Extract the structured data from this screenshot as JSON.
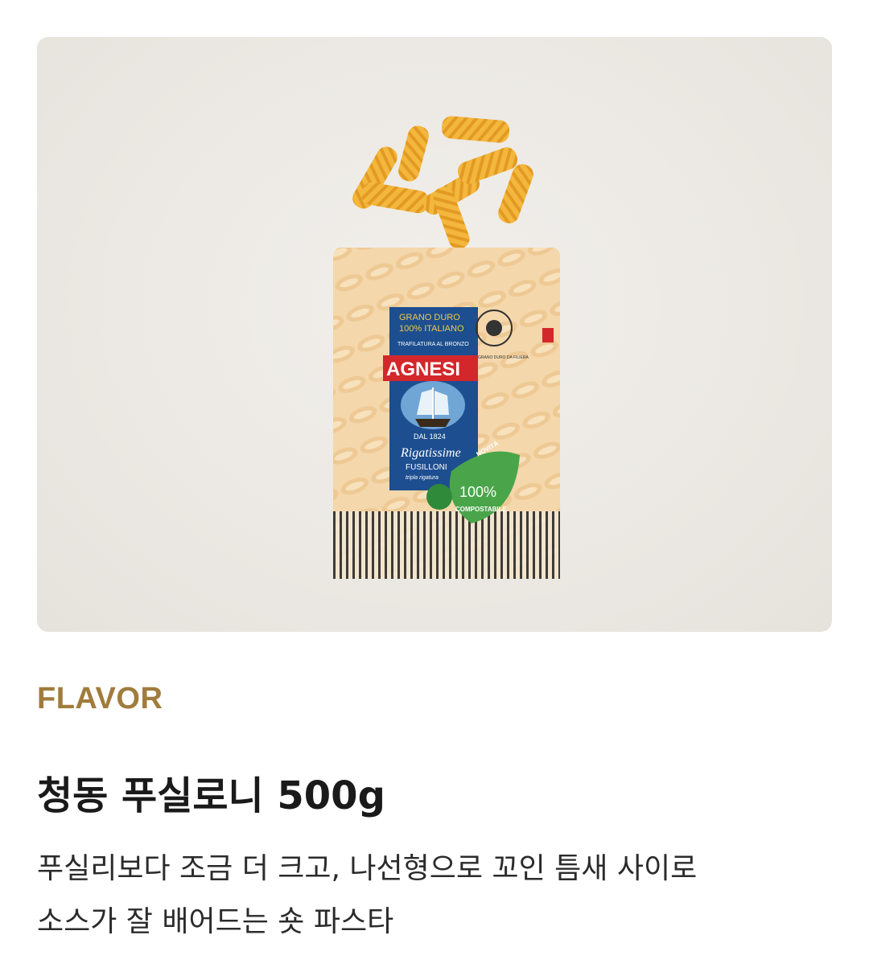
{
  "product": {
    "category_label": "FLAVOR",
    "title": "청동 푸실로니 500g",
    "description_lines": [
      "푸실리보다 조금 더 크고, 나선형으로 꼬인 틈새 사이로",
      "소스가 잘 배어드는 숏 파스타"
    ]
  },
  "package_labels": {
    "origin": "GRANO DURO",
    "origin2": "100% ITALIANO",
    "process": "TRAFILATURA AL BRONZO",
    "brand": "AGNESI",
    "since": "DAL 1824",
    "line": "Rigatissime",
    "variety": "FUSILLONI",
    "sub": "tripla rigatura",
    "badge_new": "NOVITÀ",
    "badge_pct": "100%",
    "badge_text": "COMPOSTABILE",
    "seal": "GRANO DURO DA FILIERA"
  },
  "colors": {
    "accent": "#a07c3c",
    "brand_red": "#d3272b",
    "brand_blue": "#1d4e8f",
    "pasta": "#f0b540"
  }
}
